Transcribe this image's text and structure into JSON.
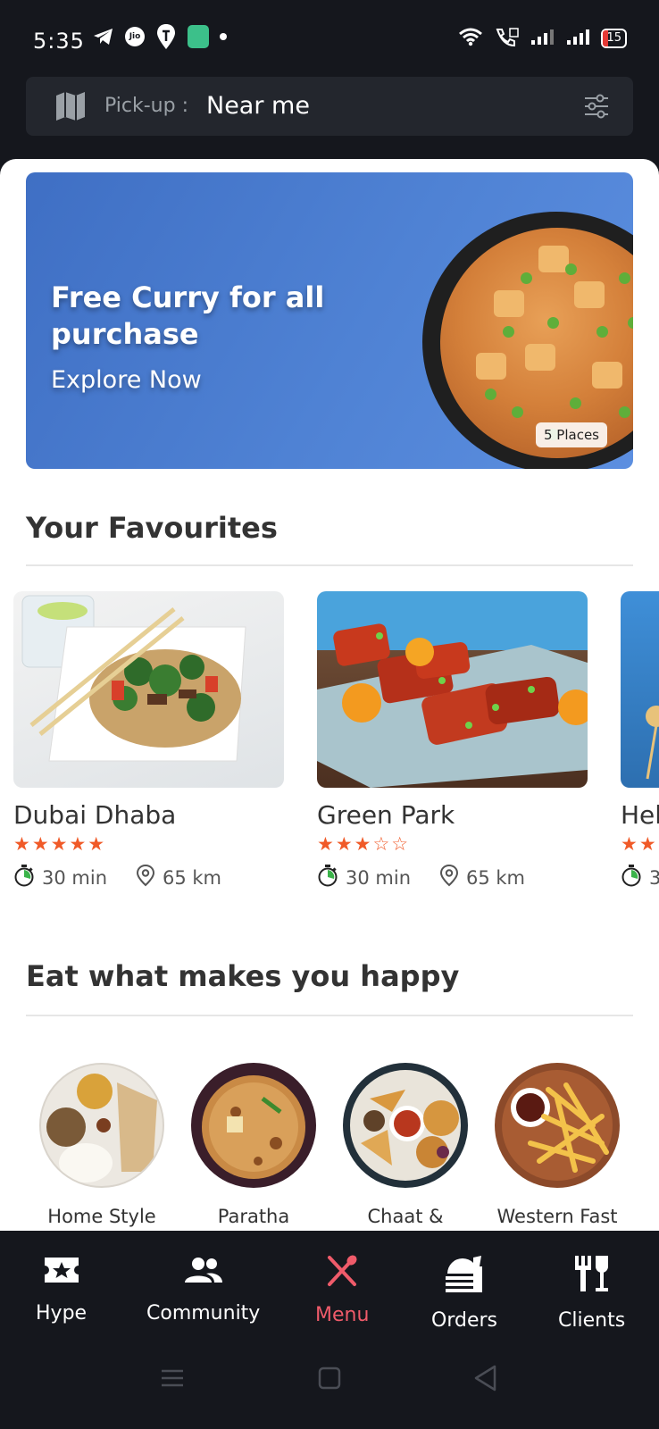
{
  "status_bar": {
    "time": "5:35",
    "carrier_badge": "Jio",
    "battery": "15"
  },
  "pickup": {
    "label": "Pick-up :",
    "value": "Near me"
  },
  "banner": {
    "title": "Free Curry for all purchase",
    "subtitle": "Explore Now",
    "badge": "5 Places"
  },
  "favourites": {
    "title": "Your Favourites",
    "items": [
      {
        "name": "Dubai Dhaba",
        "rating": 5,
        "stars": "★★★★★",
        "time": "30 min",
        "distance": "65 km"
      },
      {
        "name": "Green Park",
        "rating": 3,
        "stars": "★★★☆☆",
        "time": "30 min",
        "distance": "65 km"
      },
      {
        "name": "Hel",
        "rating": 2,
        "stars": "★★",
        "time": "3",
        "distance": ""
      }
    ]
  },
  "categories": {
    "title": "Eat what makes you happy",
    "items": [
      {
        "label": "Home Style"
      },
      {
        "label": "Paratha"
      },
      {
        "label": "Chaat &"
      },
      {
        "label": "Western Fast"
      }
    ]
  },
  "bottom_nav": {
    "items": [
      {
        "label": "Hype",
        "icon": "ticket-star-icon"
      },
      {
        "label": "Community",
        "icon": "people-icon"
      },
      {
        "label": "Menu",
        "icon": "fork-spoon-icon",
        "active": true
      },
      {
        "label": "Orders",
        "icon": "food-tray-icon"
      },
      {
        "label": "Clients",
        "icon": "utensils-glass-icon"
      }
    ]
  },
  "colors": {
    "accent": "#ef5b6a",
    "star": "#f05a28",
    "background_dark": "#15171d",
    "banner_blue": "#4f82d4"
  }
}
